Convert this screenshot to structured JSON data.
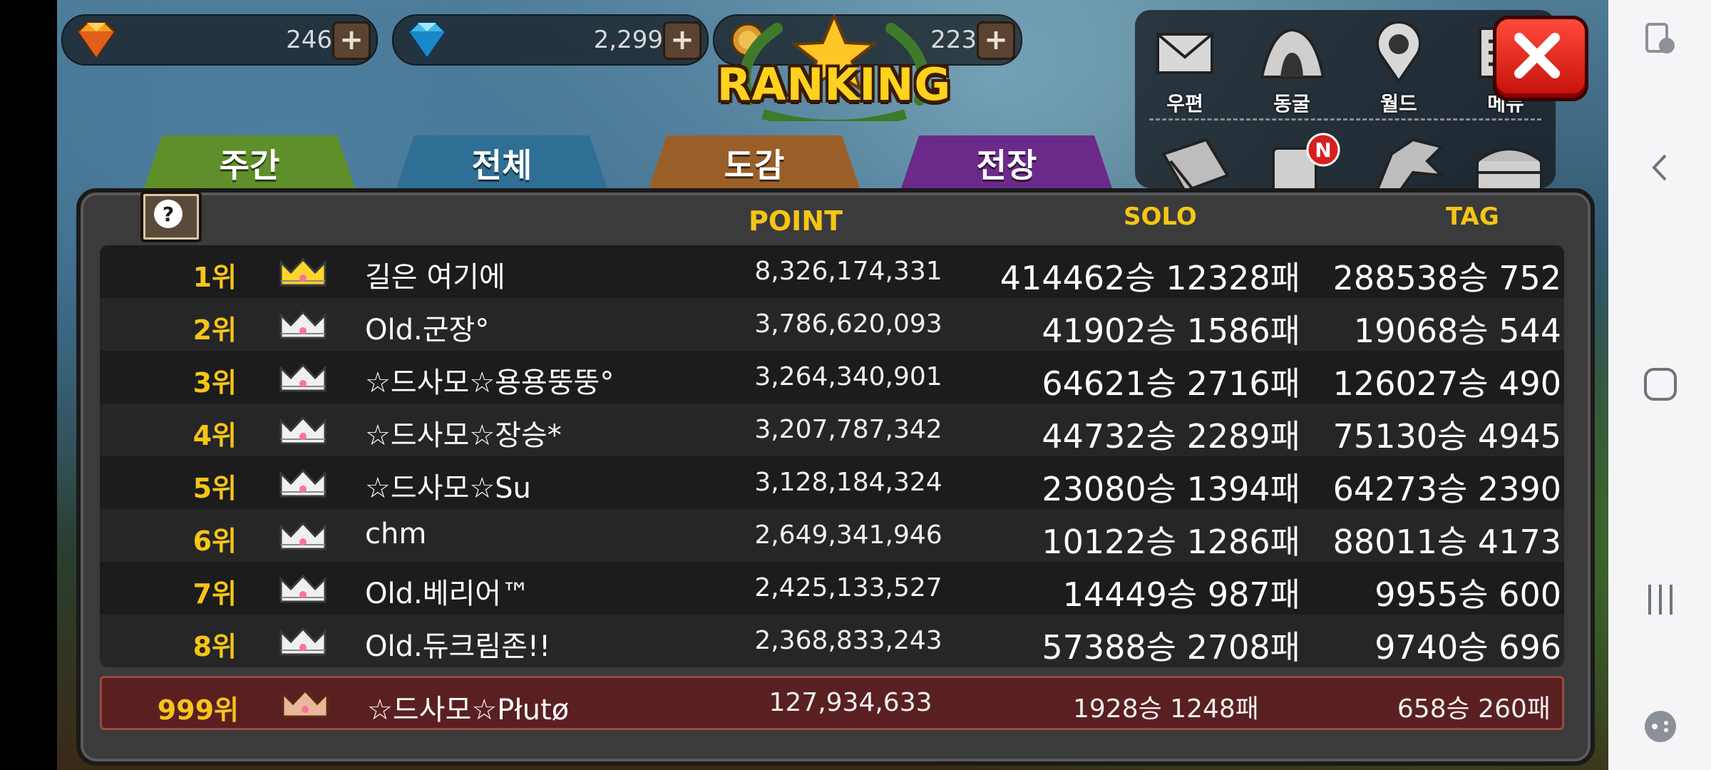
{
  "currency": {
    "ruby": {
      "amount": "246",
      "plus": "+"
    },
    "diamond": {
      "amount": "2,299",
      "plus": "+"
    },
    "coin": {
      "amount": "223",
      "plus": "+"
    }
  },
  "title": "RANKING",
  "menu": {
    "items": [
      {
        "label": "우편",
        "icon": "mail-icon"
      },
      {
        "label": "동굴",
        "icon": "cave-icon"
      },
      {
        "label": "월드",
        "icon": "world-icon"
      },
      {
        "label": "메뉴",
        "icon": "menu-icon"
      }
    ],
    "sub_icons": [
      "book-icon",
      "notice-scroll-icon",
      "dragon-icon",
      "treasure-chest-icon"
    ],
    "notice_badge": "N",
    "close": "close-icon"
  },
  "tabs": [
    {
      "label": "주간",
      "color": "#5f8f2a"
    },
    {
      "label": "전체",
      "color": "#2f6f95"
    },
    {
      "label": "도감",
      "color": "#9a5f28"
    },
    {
      "label": "전장",
      "color": "#6b2a8a"
    }
  ],
  "help_label": "?",
  "headers": {
    "point": "POINT",
    "solo": "SOLO",
    "tag": "TAG"
  },
  "rows": [
    {
      "rank": "1위",
      "name": "길은 여기에",
      "points": "8,326,174,331",
      "solo": "414462승 12328패",
      "tag": "288538승 752",
      "crown": "gold"
    },
    {
      "rank": "2위",
      "name": "Old.군장°",
      "points": "3,786,620,093",
      "solo": "41902승 1586패",
      "tag": "19068승 544",
      "crown": "silver"
    },
    {
      "rank": "3위",
      "name": "☆드사모☆용용뚱뚱°",
      "points": "3,264,340,901",
      "solo": "64621승 2716패",
      "tag": "126027승 490",
      "crown": "silver"
    },
    {
      "rank": "4위",
      "name": "☆드사모☆장승*",
      "points": "3,207,787,342",
      "solo": "44732승 2289패",
      "tag": "75130승 4945",
      "crown": "silver"
    },
    {
      "rank": "5위",
      "name": "☆드사모☆Su",
      "points": "3,128,184,324",
      "solo": "23080승 1394패",
      "tag": "64273승 2390",
      "crown": "silver"
    },
    {
      "rank": "6위",
      "name": "chm",
      "points": "2,649,341,946",
      "solo": "10122승 1286패",
      "tag": "88011승 4173",
      "crown": "silver"
    },
    {
      "rank": "7위",
      "name": "Old.베리어™",
      "points": "2,425,133,527",
      "solo": "14449승 987패",
      "tag": "9955승 600",
      "crown": "silver"
    },
    {
      "rank": "8위",
      "name": "Old.듀크림존!!",
      "points": "2,368,833,243",
      "solo": "57388승 2708패",
      "tag": "9740승 696",
      "crown": "silver"
    }
  ],
  "my_rank": {
    "rank": "999위",
    "name": "☆드사모☆Płutø",
    "points": "127,934,633",
    "solo": "1928승 1248패",
    "tag": "658승 260패",
    "crown": "bronze"
  },
  "nav": [
    "accessibility-icon",
    "back-icon",
    "home-icon",
    "recents-icon",
    "game-launcher-icon"
  ],
  "colors": {
    "gold": "#f5c518",
    "row_dark": "#1c1c1c",
    "row_light": "#262626",
    "my_row": "#5a2021"
  }
}
